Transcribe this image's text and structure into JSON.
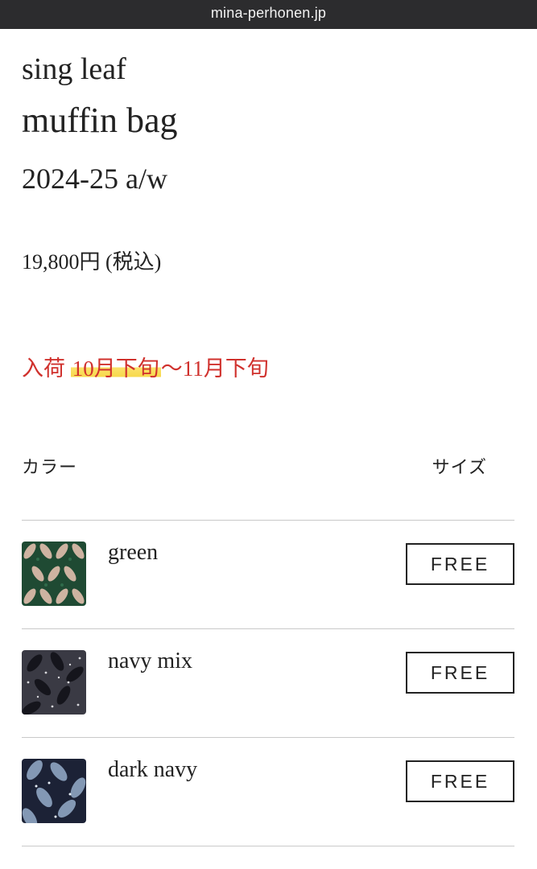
{
  "browser": {
    "url": "mina-perhonen.jp"
  },
  "product": {
    "series": "sing leaf",
    "name": "muffin bag",
    "season": "2024-25 a/w",
    "price": "19,800円 (税込)"
  },
  "arrival": {
    "prefix": "入荷 ",
    "highlighted": "10月下旬",
    "suffix": "～11月下旬",
    "color": "#d0312d",
    "highlight_color": "#f7d84a"
  },
  "table": {
    "color_header": "カラー",
    "size_header": "サイズ"
  },
  "variants": [
    {
      "name": "green",
      "size": "FREE",
      "swatch": {
        "icon": "green-leaf-pattern-swatch",
        "bg": "#1f4a33",
        "fg": "#d9b9a8"
      }
    },
    {
      "name": "navy mix",
      "size": "FREE",
      "swatch": {
        "icon": "navy-mix-leaf-pattern-swatch",
        "bg": "#3a3a44",
        "fg": "#d8d8dc"
      }
    },
    {
      "name": "dark navy",
      "size": "FREE",
      "swatch": {
        "icon": "dark-navy-leaf-pattern-swatch",
        "bg": "#1c2236",
        "fg": "#8fa6c2"
      }
    }
  ]
}
